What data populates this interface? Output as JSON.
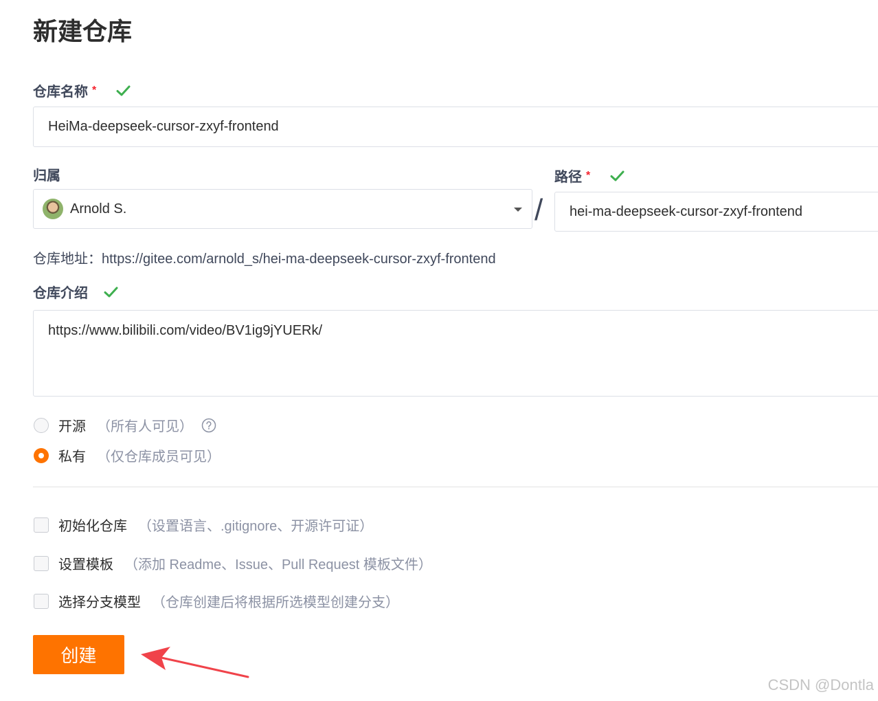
{
  "page": {
    "title": "新建仓库"
  },
  "repo_name": {
    "label": "仓库名称",
    "required_mark": "*",
    "value": "HeiMa-deepseek-cursor-zxyf-frontend"
  },
  "owner": {
    "label": "归属",
    "selected": "Arnold S."
  },
  "path": {
    "separator": "/",
    "label": "路径",
    "required_mark": "*",
    "value": "hei-ma-deepseek-cursor-zxyf-frontend"
  },
  "repo_address": {
    "text": "仓库地址：https://gitee.com/arnold_s/hei-ma-deepseek-cursor-zxyf-frontend"
  },
  "description": {
    "label": "仓库介绍",
    "value": "https://www.bilibili.com/video/BV1ig9jYUERk/"
  },
  "visibility": {
    "options": [
      {
        "label": "开源",
        "hint": "（所有人可见）",
        "checked": false
      },
      {
        "label": "私有",
        "hint": "（仅仓库成员可见）",
        "checked": true
      }
    ]
  },
  "options": [
    {
      "label": "初始化仓库",
      "hint": "（设置语言、.gitignore、开源许可证）",
      "checked": false
    },
    {
      "label": "设置模板",
      "hint": "（添加 Readme、Issue、Pull Request 模板文件）",
      "checked": false
    },
    {
      "label": "选择分支模型",
      "hint": "（仓库创建后将根据所选模型创建分支）",
      "checked": false
    }
  ],
  "actions": {
    "create_label": "创建"
  },
  "watermark": "CSDN @Dontla",
  "colors": {
    "accent": "#fe7300",
    "valid_check": "#3eaf4f",
    "required": "#f5222d",
    "annotation_arrow": "#f0434a"
  },
  "icons": {
    "valid": "check-icon",
    "help": "question-circle-icon",
    "dropdown": "caret-down-icon"
  }
}
